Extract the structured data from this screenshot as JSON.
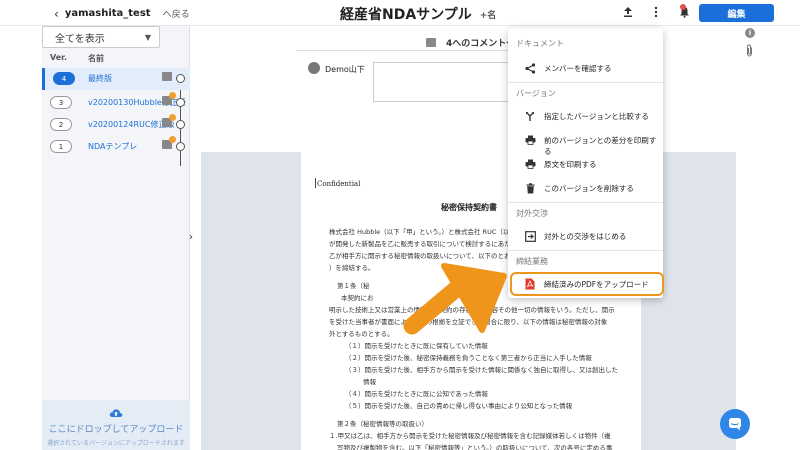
{
  "header": {
    "back_user": "yamashita_test",
    "back_label": "へ戻る",
    "title": "経産省NDAサンプル",
    "share_label": "+名",
    "edit_label": "編集"
  },
  "sidebar": {
    "filter_value": "全てを表示",
    "col_ver": "Ver.",
    "col_name": "名前",
    "versions": [
      {
        "num": "4",
        "name": "最終版"
      },
      {
        "num": "3",
        "name": "v20200130Hubble修正版"
      },
      {
        "num": "2",
        "name": "v20200124RUC修正版"
      },
      {
        "num": "1",
        "name": "NDAテンプレ"
      }
    ],
    "drop_title": "ここにドロップしてアップロード",
    "drop_sub": "選択されているバージョンにアップロードされます"
  },
  "comments": {
    "header": "4へのコメント一覧",
    "user": "Demo山下"
  },
  "paper": {
    "confidential": "Confidential",
    "title": "秘密保持契約書",
    "lines": [
      "株式会社 Hubble（以下「甲」という。）と株式会社 RUC（以下",
      "が開発した新製品を乙に販売する取引について検討するにあたり",
      "乙が相手方に開示する秘密情報の取扱いについて、以下のとおり",
      "）を締結する。",
      "第１条（秘",
      "本契約にお",
      "明示した技術上又は営業上の情報、本契約の存在及び内容その他一切の情報をいう。ただし、開示",
      "を受けた当事者が書面によってその根拠を立証できる場合に限り、以下の情報は秘密情報の対象",
      "外とするものとする。",
      "（１）開示を受けたときに既に保有していた情報",
      "（２）開示を受けた後、秘密保持義務を負うことなく第三者から正当に入手した情報",
      "（３）開示を受けた後、相手方から開示を受けた情報に関係なく独自に取得し、又は創出した",
      "情報",
      "（４）開示を受けたときに既に公知であった情報",
      "（５）開示を受けた後、自己の責めに帰し得ない事由により公知となった情報",
      "第２条（秘密情報等の取扱い）",
      "１.甲又は乙は、相手方から開示を受けた秘密情報及び秘密情報を含む記録媒体若しくは物件（複",
      "写物及び複製物を含む。以下「秘密情報等」という。）の取扱いについて、次の各号に定める事",
      "項を遵守するものとする。",
      "（１）情報取扱管理者を定め、相手方から開示された秘密情報等を、善良なる管理者としての"
    ]
  },
  "menu": {
    "sec_document": "ドキュメント",
    "share_members": "メンバーを確認する",
    "sec_version": "バージョン",
    "compare": "指定したバージョンと比較する",
    "print_diff": "前のバージョンとの差分を印刷する",
    "print_original": "原文を印刷する",
    "delete_version": "このバージョンを削除する",
    "sec_external": "対外交渉",
    "start_negotiation": "対外との交渉をはじめる",
    "sec_contract": "締結業務",
    "upload_pdf": "締結済みのPDFをアップロード"
  }
}
